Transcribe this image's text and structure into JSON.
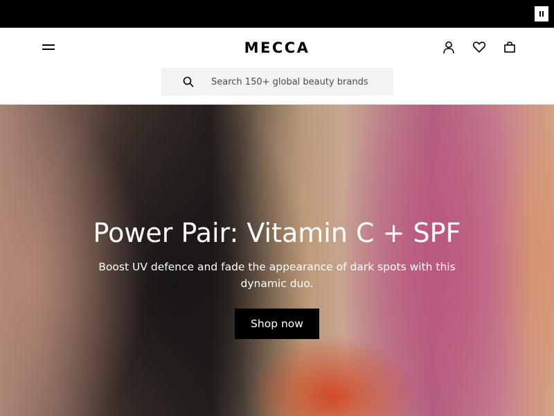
{
  "announcement_bar": {
    "pause_icon": "pause-icon"
  },
  "header": {
    "menu_icon": "hamburger-menu-icon",
    "logo_text": "MECCA",
    "account_icon": "user-icon",
    "wishlist_icon": "heart-icon",
    "bag_icon": "shopping-bag-icon"
  },
  "search": {
    "icon": "search-icon",
    "placeholder": "Search 150+ global beauty brands",
    "value": ""
  },
  "hero": {
    "title": "Power Pair: Vitamin C + SPF",
    "subtitle": "Boost UV defence and fade the appearance of dark spots with this dynamic duo.",
    "cta_label": "Shop now"
  },
  "colors": {
    "topbar": "#000000",
    "header_bg": "#ffffff",
    "search_bg": "#f3f3f3",
    "cta_bg": "#000000",
    "hero_text": "#ffffff"
  }
}
